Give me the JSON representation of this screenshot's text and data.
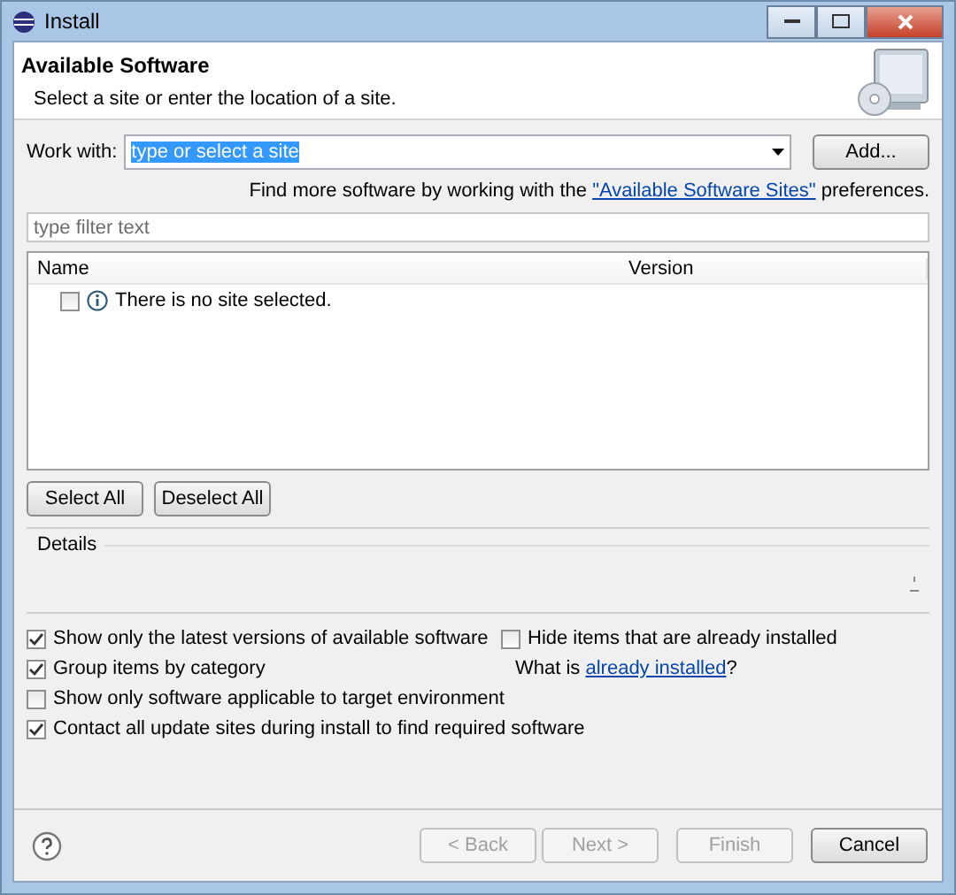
{
  "window": {
    "title": "Install"
  },
  "header": {
    "title": "Available Software",
    "subtitle": "Select a site or enter the location of a site."
  },
  "work_with": {
    "label": "Work with:",
    "value": "type or select a site",
    "add_button": "Add..."
  },
  "more_software": {
    "prefix": "Find more software by working with the ",
    "link": "\"Available Software Sites\"",
    "suffix": " preferences."
  },
  "filter": {
    "placeholder": "type filter text"
  },
  "table": {
    "columns": [
      "Name",
      "Version"
    ],
    "rows": [
      {
        "text": "There is no site selected.",
        "checked": false
      }
    ]
  },
  "selection_buttons": [
    "Select All",
    "Deselect All"
  ],
  "details": {
    "label": "Details"
  },
  "options_left": [
    {
      "label": "Show only the latest versions of available software",
      "checked": true
    },
    {
      "label": "Group items by category",
      "checked": true
    },
    {
      "label": "Show only software applicable to target environment",
      "checked": false
    },
    {
      "label": "Contact all update sites during install to find required software",
      "checked": true
    }
  ],
  "options_right": [
    {
      "label": "Hide items that are already installed",
      "checked": false
    }
  ],
  "installed_note": {
    "prefix": "What is ",
    "link": "already installed",
    "suffix": "?"
  },
  "footer_buttons": [
    {
      "label": "< Back",
      "disabled": true
    },
    {
      "label": "Next >",
      "disabled": true
    },
    {
      "label": "Finish",
      "disabled": true
    },
    {
      "label": "Cancel",
      "disabled": false
    }
  ]
}
